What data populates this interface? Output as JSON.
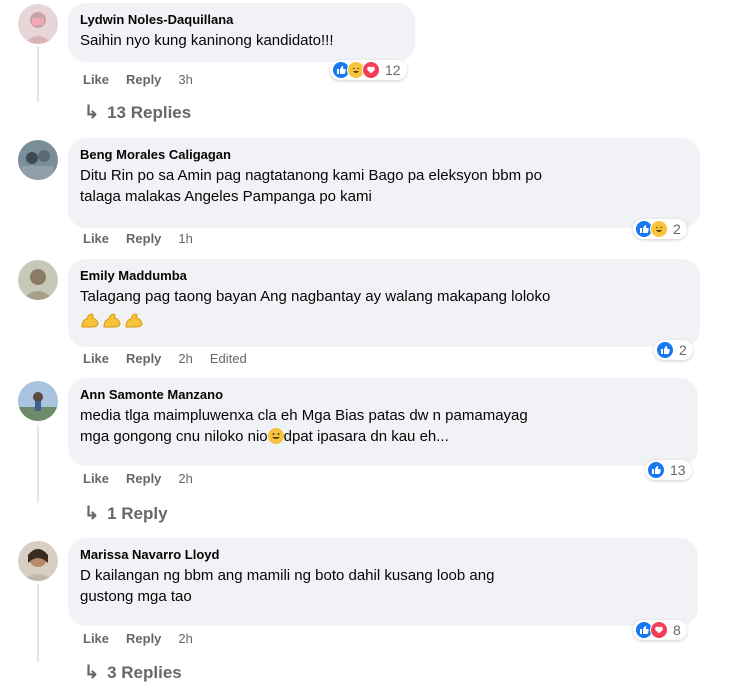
{
  "comments": [
    {
      "name": "Lydwin Noles-Daquillana",
      "text": "Saihin nyo kung kaninong kandidato!!!",
      "like": "Like",
      "reply": "Reply",
      "time": "3h",
      "reaction_count": "12",
      "reactions": [
        "like",
        "haha",
        "love"
      ],
      "replies": "13 Replies"
    },
    {
      "name": "Beng Morales Caligagan",
      "text_line1": "Ditu Rin po sa Amin pag nagtatanong kami Bago pa eleksyon bbm po",
      "text_line2": "talaga malakas Angeles Pampanga po kami",
      "like": "Like",
      "reply": "Reply",
      "time": "1h",
      "reaction_count": "2",
      "reactions": [
        "like",
        "haha"
      ]
    },
    {
      "name": "Emily Maddumba",
      "text": "Talagang pag taong bayan Ang nagbantay ay walang makapang loloko",
      "emojis": [
        "flexed-biceps",
        "flexed-biceps",
        "flexed-biceps"
      ],
      "like": "Like",
      "reply": "Reply",
      "time": "2h",
      "edited": "Edited",
      "reaction_count": "2",
      "reactions": [
        "like"
      ]
    },
    {
      "name": "Ann Samonte Manzano",
      "text_line1": "media tlga maimpluwenxa cla eh Mga Bias patas dw n pamamayag",
      "text_line2a": "mga gongong cnu niloko nio",
      "text_line2b": "dpat ipasara dn kau eh...",
      "like": "Like",
      "reply": "Reply",
      "time": "2h",
      "reaction_count": "13",
      "reactions": [
        "like"
      ],
      "replies": "1 Reply"
    },
    {
      "name": "Marissa Navarro Lloyd",
      "text_line1": "D kailangan ng bbm ang mamili ng boto dahil kusang loob ang",
      "text_line2": "gustong mga tao",
      "like": "Like",
      "reply": "Reply",
      "time": "2h",
      "reaction_count": "8",
      "reactions": [
        "like",
        "love"
      ],
      "replies": "3 Replies"
    }
  ],
  "colors": {
    "bubble": "#f0f2f5",
    "meta": "#65676b",
    "like": "#1877f2",
    "haha": "#f7c33b",
    "love": "#f33e58"
  }
}
